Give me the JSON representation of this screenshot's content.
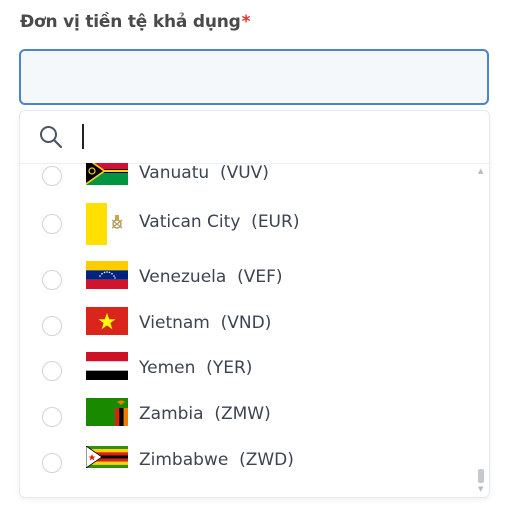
{
  "field": {
    "label": "Đơn vị tiền tệ khả dụng",
    "required_mark": "*",
    "value": ""
  },
  "search": {
    "icon": "search-icon",
    "value": ""
  },
  "options": [
    {
      "name": "Vanuatu",
      "code": "(VUV)",
      "label": "Vanuatu  (VUV)",
      "flag": "vanuatu-flag",
      "selected": false
    },
    {
      "name": "Vatican City",
      "code": "(EUR)",
      "label": "Vatican City  (EUR)",
      "flag": "vatican-flag",
      "selected": false
    },
    {
      "name": "Venezuela",
      "code": "(VEF)",
      "label": "Venezuela  (VEF)",
      "flag": "venezuela-flag",
      "selected": false
    },
    {
      "name": "Vietnam",
      "code": "(VND)",
      "label": "Vietnam  (VND)",
      "flag": "vietnam-flag",
      "selected": false
    },
    {
      "name": "Yemen",
      "code": "(YER)",
      "label": "Yemen  (YER)",
      "flag": "yemen-flag",
      "selected": false
    },
    {
      "name": "Zambia",
      "code": "(ZMW)",
      "label": "Zambia  (ZMW)",
      "flag": "zambia-flag",
      "selected": false
    },
    {
      "name": "Zimbabwe",
      "code": "(ZWD)",
      "label": "Zimbabwe  (ZWD)",
      "flag": "zimbabwe-flag",
      "selected": false
    }
  ],
  "colors": {
    "accent_border": "#4a84c9",
    "required": "#e5302b",
    "text": "#3d4451"
  }
}
